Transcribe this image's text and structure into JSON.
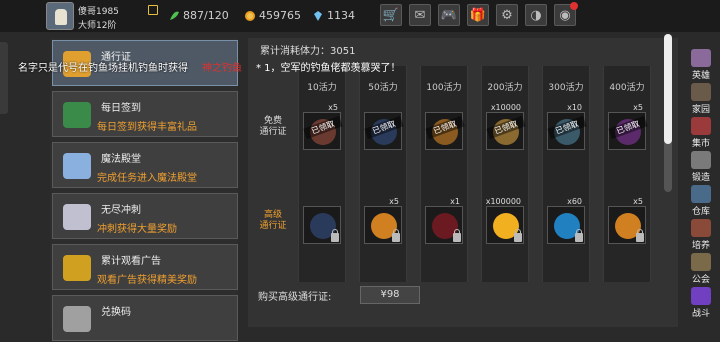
{
  "player": {
    "name": "傻哥1985",
    "rank": "大师12阶"
  },
  "resources": {
    "stamina": "887/120",
    "coins": "459765",
    "gems": "1134"
  },
  "toolbar": [
    "shopping-cart-icon",
    "mail-icon",
    "gamepad-icon",
    "gift-icon",
    "settings-gear-icon",
    "color-wheel-icon",
    "chrome-icon"
  ],
  "menu": [
    {
      "title": "通行证",
      "sub": "",
      "icon": "trophy-icon",
      "active": true
    },
    {
      "title": "每日签到",
      "sub": "每日签到获得丰富礼品",
      "icon": "treasure-chest-icon",
      "active": false
    },
    {
      "title": "魔法殿堂",
      "sub": "完成任务进入魔法殿堂",
      "icon": "magic-crystal-icon",
      "active": false
    },
    {
      "title": "无尽冲刺",
      "sub": "冲刺获得大量奖励",
      "icon": "knight-icon",
      "active": false
    },
    {
      "title": "累计观看广告",
      "sub": "观看广告获得精美奖励",
      "icon": "gold-chest-icon",
      "active": false
    },
    {
      "title": "兑换码",
      "sub": "",
      "icon": "redeem-icon",
      "active": false
    }
  ],
  "panel": {
    "title": "累计消耗体力：3051",
    "tip_white": "名字只是代号在钓鱼场挂机钓鱼时获得",
    "tip_red": "神之钓鱼",
    "tip_cont": "* 1，空军的钓鱼佬都羡慕哭了！",
    "free_label": "免费\n通行证",
    "premium_label": "高级\n通行证",
    "claimed_text": "已领取",
    "buy_label": "购买高级通行证:",
    "buy_price": "¥98"
  },
  "columns": [
    {
      "head": "10活力",
      "free_count": "x5",
      "free_icon": "green-gem-icon",
      "free_color": "#6a3a30",
      "premium_count": "",
      "premium_icon": "armored-figure-icon",
      "premium_color": "#2a3a5a"
    },
    {
      "head": "50活力",
      "free_count": "",
      "free_icon": "shield-emblem-icon",
      "free_color": "#2a3a5a",
      "premium_count": "x5",
      "premium_icon": "ic-token-icon",
      "premium_color": "#d08020"
    },
    {
      "head": "100活力",
      "free_count": "",
      "free_icon": "orange-orb-icon",
      "free_color": "#8a5a20",
      "premium_count": "x1",
      "premium_icon": "mystery-box-icon",
      "premium_color": "#6a1a20"
    },
    {
      "head": "200活力",
      "free_count": "x10000",
      "free_icon": "bronze-coin-icon",
      "free_color": "#8a6a30",
      "premium_count": "x100000",
      "premium_icon": "gold-coin-icon",
      "premium_color": "#f0b020"
    },
    {
      "head": "300活力",
      "free_count": "x10",
      "free_icon": "lightning-icon",
      "free_color": "#3a5a6a",
      "premium_count": "x60",
      "premium_icon": "blue-lightning-icon",
      "premium_color": "#2080c0"
    },
    {
      "head": "400活力",
      "free_count": "x5",
      "free_icon": "purple-orb-icon",
      "free_color": "#5a2a6a",
      "premium_count": "x5",
      "premium_icon": "ic-token-icon",
      "premium_color": "#d08020"
    }
  ],
  "side_nav": [
    {
      "label": "英雄",
      "icon": "hero-icon",
      "color": "#8a6a9a"
    },
    {
      "label": "家园",
      "icon": "home-icon",
      "color": "#6a5a4a"
    },
    {
      "label": "集市",
      "icon": "market-icon",
      "color": "#9a3a3a"
    },
    {
      "label": "锻造",
      "icon": "anvil-icon",
      "color": "#7a7a7a"
    },
    {
      "label": "仓库",
      "icon": "warehouse-icon",
      "color": "#4a6a8a"
    },
    {
      "label": "培养",
      "icon": "training-icon",
      "color": "#8a4a3a"
    },
    {
      "label": "公会",
      "icon": "guild-icon",
      "color": "#7a6a4a"
    },
    {
      "label": "战斗",
      "icon": "battle-portal-icon",
      "color": "#7040c0"
    }
  ]
}
